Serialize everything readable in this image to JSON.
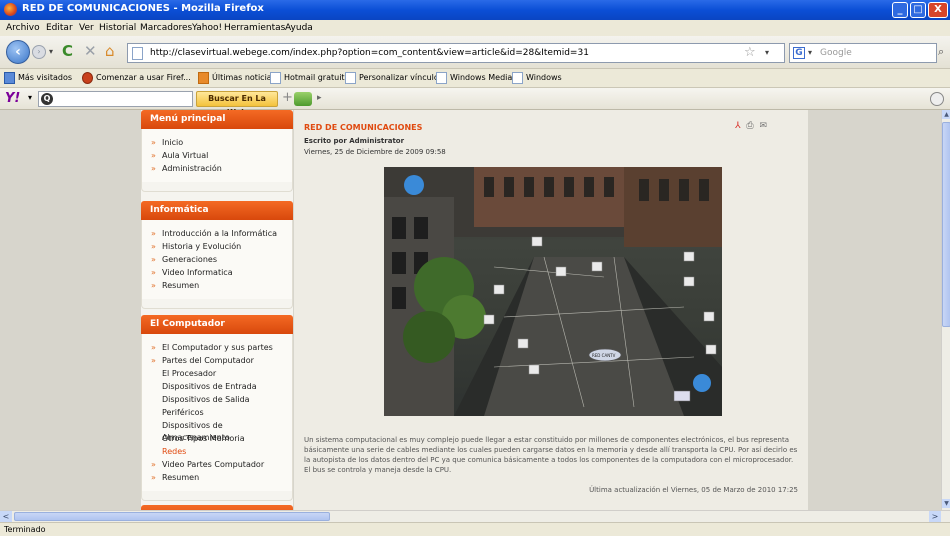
{
  "window": {
    "title": "RED DE COMUNICACIONES - Mozilla Firefox",
    "min_label": "_",
    "max_label": "□",
    "close_label": "X"
  },
  "menubar": {
    "items": [
      "Archivo",
      "Editar",
      "Ver",
      "Historial",
      "Marcadores",
      "Yahoo!",
      "Herramientas",
      "Ayuda"
    ]
  },
  "navbar": {
    "back_glyph": "‹",
    "forward_glyph": "›",
    "dropdown_glyph": "▾",
    "reload_glyph": "C",
    "stop_glyph": "✕",
    "home_glyph": "⌂",
    "url": "http://clasevirtual.webege.com/index.php?option=com_content&view=article&id=28&Itemid=31",
    "star_glyph": "☆",
    "search_placeholder": "Google",
    "search_engine_glyph": "G",
    "search_go_glyph": "⌕"
  },
  "bookmarks": [
    {
      "label": "Más visitados",
      "icon": "most-visited-icon"
    },
    {
      "label": "Comenzar a usar Firef...",
      "icon": "firefox-icon"
    },
    {
      "label": "Últimas noticias",
      "icon": "rss-icon"
    },
    {
      "label": "Hotmail gratuito",
      "icon": "page-icon"
    },
    {
      "label": "Personalizar vínculos",
      "icon": "page-icon"
    },
    {
      "label": "Windows Media",
      "icon": "page-icon"
    },
    {
      "label": "Windows",
      "icon": "page-icon"
    }
  ],
  "yahoo_toolbar": {
    "logo": "Y!",
    "dropdown": "▾",
    "input_icon": "Q",
    "search_button": "Buscar En La Web",
    "plus": "+",
    "arrow": "▸"
  },
  "sidebar": {
    "modules": [
      {
        "title": "Menú principal",
        "items": [
          {
            "label": "Inicio",
            "bullet": true
          },
          {
            "label": "Aula Virtual",
            "bullet": true
          },
          {
            "label": "Administración",
            "bullet": true
          }
        ]
      },
      {
        "title": "Informática",
        "items": [
          {
            "label": "Introducción a la Informática",
            "bullet": true
          },
          {
            "label": "Historia y Evolución",
            "bullet": true
          },
          {
            "label": "Generaciones",
            "bullet": true
          },
          {
            "label": "Video Informatica",
            "bullet": true
          },
          {
            "label": "Resumen",
            "bullet": true
          }
        ]
      },
      {
        "title": "El Computador",
        "items": [
          {
            "label": "El Computador y sus partes",
            "bullet": true
          },
          {
            "label": "Partes del Computador",
            "bullet": true
          },
          {
            "label": "El Procesador",
            "bullet": false
          },
          {
            "label": "Dispositivos de Entrada",
            "bullet": false
          },
          {
            "label": "Dispositivos de Salida",
            "bullet": false
          },
          {
            "label": "Periféricos",
            "bullet": false
          },
          {
            "label": "Dispositivos de Almacenamiento",
            "bullet": false
          },
          {
            "label": "Otros Tipos Memoria",
            "bullet": false
          },
          {
            "label": "Redes",
            "bullet": false,
            "active": true
          },
          {
            "label": "Video Partes Computador",
            "bullet": true
          },
          {
            "label": "Resumen",
            "bullet": true
          }
        ]
      }
    ],
    "bullet_glyph": "»"
  },
  "article": {
    "title": "RED DE COMUNICACIONES",
    "author": "Escrito por Administrator",
    "date": "Viernes, 25 de Diciembre de 2009 09:58",
    "image_label": "RED CANTV",
    "icons": {
      "pdf": "⅄",
      "print": "⎙",
      "email": "✉"
    },
    "body": "Un sistema computacional es muy complejo  puede llegar a estar constituido por millones de componentes electrónicos, el bus representa básicamente una serie  de cables mediante los cuales pueden cargarse  datos en la memoria y desde allí  transporta la CPU. Por así  decirlo es la autopista de los datos dentro del PC ya que comunica básicamente a todos  los componentes de la  computadora con el microprocesador. El bus se controla y maneja desde la CPU.",
    "updated": "Última actualización el Viernes, 05 de Marzo de 2010 17:25"
  },
  "scrollbars": {
    "up": "▲",
    "down": "▼",
    "left": "<",
    "right": ">"
  },
  "status": {
    "text": "Terminado"
  },
  "colors": {
    "accent": "#e04a10",
    "module_header": "#f05a1a",
    "titlebar": "#0b4fd6"
  }
}
